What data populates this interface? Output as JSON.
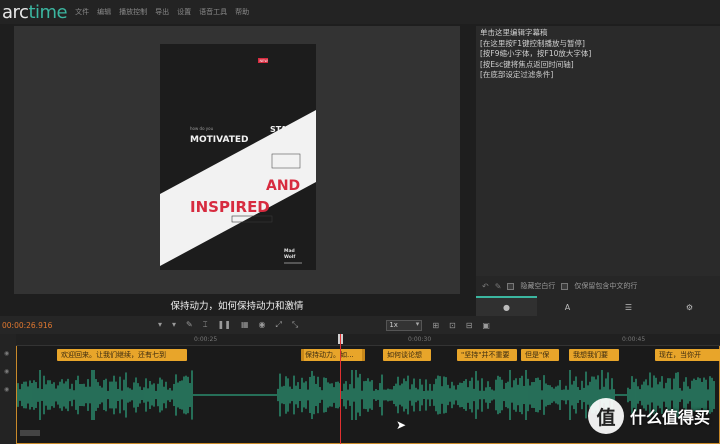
{
  "app": {
    "logo_prefix": "arc",
    "logo_suffix": "time"
  },
  "menu": [
    {
      "label": "文件"
    },
    {
      "label": "编辑"
    },
    {
      "label": "播放控制"
    },
    {
      "label": "导出"
    },
    {
      "label": "设置"
    },
    {
      "label": "语音工具"
    },
    {
      "label": "帮助"
    }
  ],
  "poster": {
    "badge": "NEW",
    "small_line": "how do you",
    "word1": "MOTIVATED",
    "word2": "STAY",
    "word3": "AND",
    "word4": "INSPIRED",
    "brand_line1": "Mad",
    "brand_line2": "Wolf"
  },
  "preview": {
    "subtitle": "保持动力，如何保持动力和激情"
  },
  "editor": {
    "lines": [
      "单击这里编辑字幕稿",
      "[在这里按F1键控制播放与暂停]",
      "[按F9缩小字体，按F10放大字体]",
      "[按Esc键将焦点返回时间轴]",
      "[在底部设定过滤条件]"
    ],
    "option1": "隐藏空白行",
    "option2": "仅保留包含中文的行"
  },
  "toolbar": {
    "timecode": "00:00:26.916",
    "speed": "1x"
  },
  "ruler": {
    "labels": [
      "0:00:25",
      "0:00:30",
      "0:00:45"
    ]
  },
  "clips": [
    {
      "text": "欢迎回来。让我们继续，还有七到"
    },
    {
      "text": "保持动力。如..."
    },
    {
      "text": "如何谈论想"
    },
    {
      "text": "\"坚持\"并不重要"
    },
    {
      "text": "但是\"保"
    },
    {
      "text": "我想我们要"
    },
    {
      "text": "现在，当你开"
    }
  ],
  "colors": {
    "accent": "#3bb6a0",
    "clip": "#e8a52a",
    "playhead": "#e03030",
    "poster_red": "#d72b3f",
    "waveform": "#2fa882"
  },
  "watermark": {
    "badge": "值",
    "text": "什么值得买"
  }
}
